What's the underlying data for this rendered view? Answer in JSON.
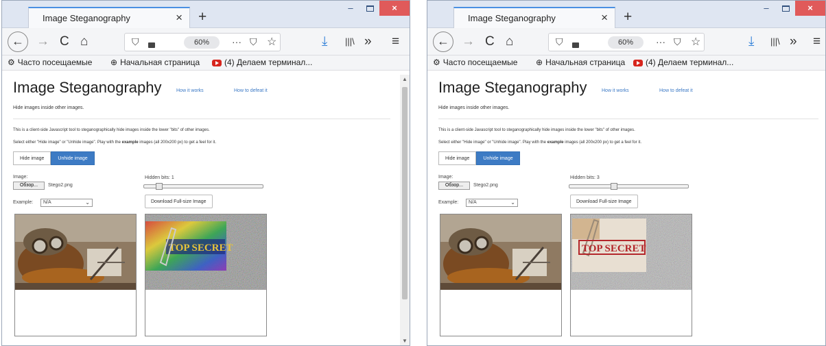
{
  "windows": [
    {
      "tab_title": "Image Steganography",
      "tab_close": "×",
      "new_tab": "+",
      "controls": {
        "minimize": "–",
        "close": "×"
      },
      "nav": {
        "back": "←",
        "forward": "→",
        "reload": "C",
        "home": "⌂"
      },
      "url": {
        "shield": "⛉",
        "zoom": "60%",
        "more": "···",
        "pocket": "⛉",
        "star": "☆"
      },
      "toolbar": {
        "download": "⤓",
        "library": "|||\\",
        "overflow": "»",
        "menu": "≡"
      },
      "bookmarks": [
        {
          "icon": "⚙",
          "label": "Часто посещаемые"
        },
        {
          "icon": "⊕",
          "label": "Начальная страница"
        },
        {
          "icon": "youtube",
          "label": "(4) Делаем терминал..."
        }
      ],
      "page": {
        "title": "Image Steganography",
        "link_how": "How it works",
        "link_defeat": "How to defeat it",
        "subtitle": "Hide images inside other images.",
        "para1": "This is a client-side Javascript tool to steganographically hide images inside the lower \"bits\" of other images.",
        "para2_a": "Select either \"Hide image\" or \"Unhide image\". Play with the ",
        "para2_b": "example",
        "para2_c": " images (all 200x200 px) to get a feel for it.",
        "btn_hide": "Hide image",
        "btn_unhide": "Unhide image",
        "image_label": "Image:",
        "browse": "Обзор...",
        "file_name": "Stego2.png",
        "example_label": "Example:",
        "example_value": "N/A",
        "hidden_bits_label": "Hidden bits: 1",
        "hidden_bits_value": 1,
        "download": "Download Full-size Image",
        "secret_text": "TOP SECRET"
      },
      "has_scrollbar": true
    },
    {
      "tab_title": "Image Steganography",
      "tab_close": "×",
      "new_tab": "+",
      "controls": {
        "minimize": "–",
        "close": "×"
      },
      "nav": {
        "back": "←",
        "forward": "→",
        "reload": "C",
        "home": "⌂"
      },
      "url": {
        "shield": "⛉",
        "zoom": "60%",
        "more": "···",
        "pocket": "⛉",
        "star": "☆"
      },
      "toolbar": {
        "download": "⤓",
        "library": "|||\\",
        "overflow": "»",
        "menu": "≡"
      },
      "bookmarks": [
        {
          "icon": "⚙",
          "label": "Часто посещаемые"
        },
        {
          "icon": "⊕",
          "label": "Начальная страница"
        },
        {
          "icon": "youtube",
          "label": "(4) Делаем терминал..."
        }
      ],
      "page": {
        "title": "Image Steganography",
        "link_how": "How it works",
        "link_defeat": "How to defeat it",
        "subtitle": "Hide images inside other images.",
        "para1": "This is a client-side Javascript tool to steganographically hide images inside the lower \"bits\" of other images.",
        "para2_a": "Select either \"Hide image\" or \"Unhide image\". Play with the ",
        "para2_b": "example",
        "para2_c": " images (all 200x200 px) to get a feel for it.",
        "btn_hide": "Hide image",
        "btn_unhide": "Unhide image",
        "image_label": "Image:",
        "browse": "Обзор...",
        "file_name": "Stego2.png",
        "example_label": "Example:",
        "example_value": "N/A",
        "hidden_bits_label": "Hidden bits: 3",
        "hidden_bits_value": 3,
        "download": "Download Full-size Image",
        "secret_text": "TOP SECRET"
      },
      "has_scrollbar": false
    }
  ],
  "colors": {
    "accent": "#3d7bc4",
    "link": "#3a78c5",
    "close_button": "#e05a5a",
    "stamp_red": "#b3262a"
  }
}
